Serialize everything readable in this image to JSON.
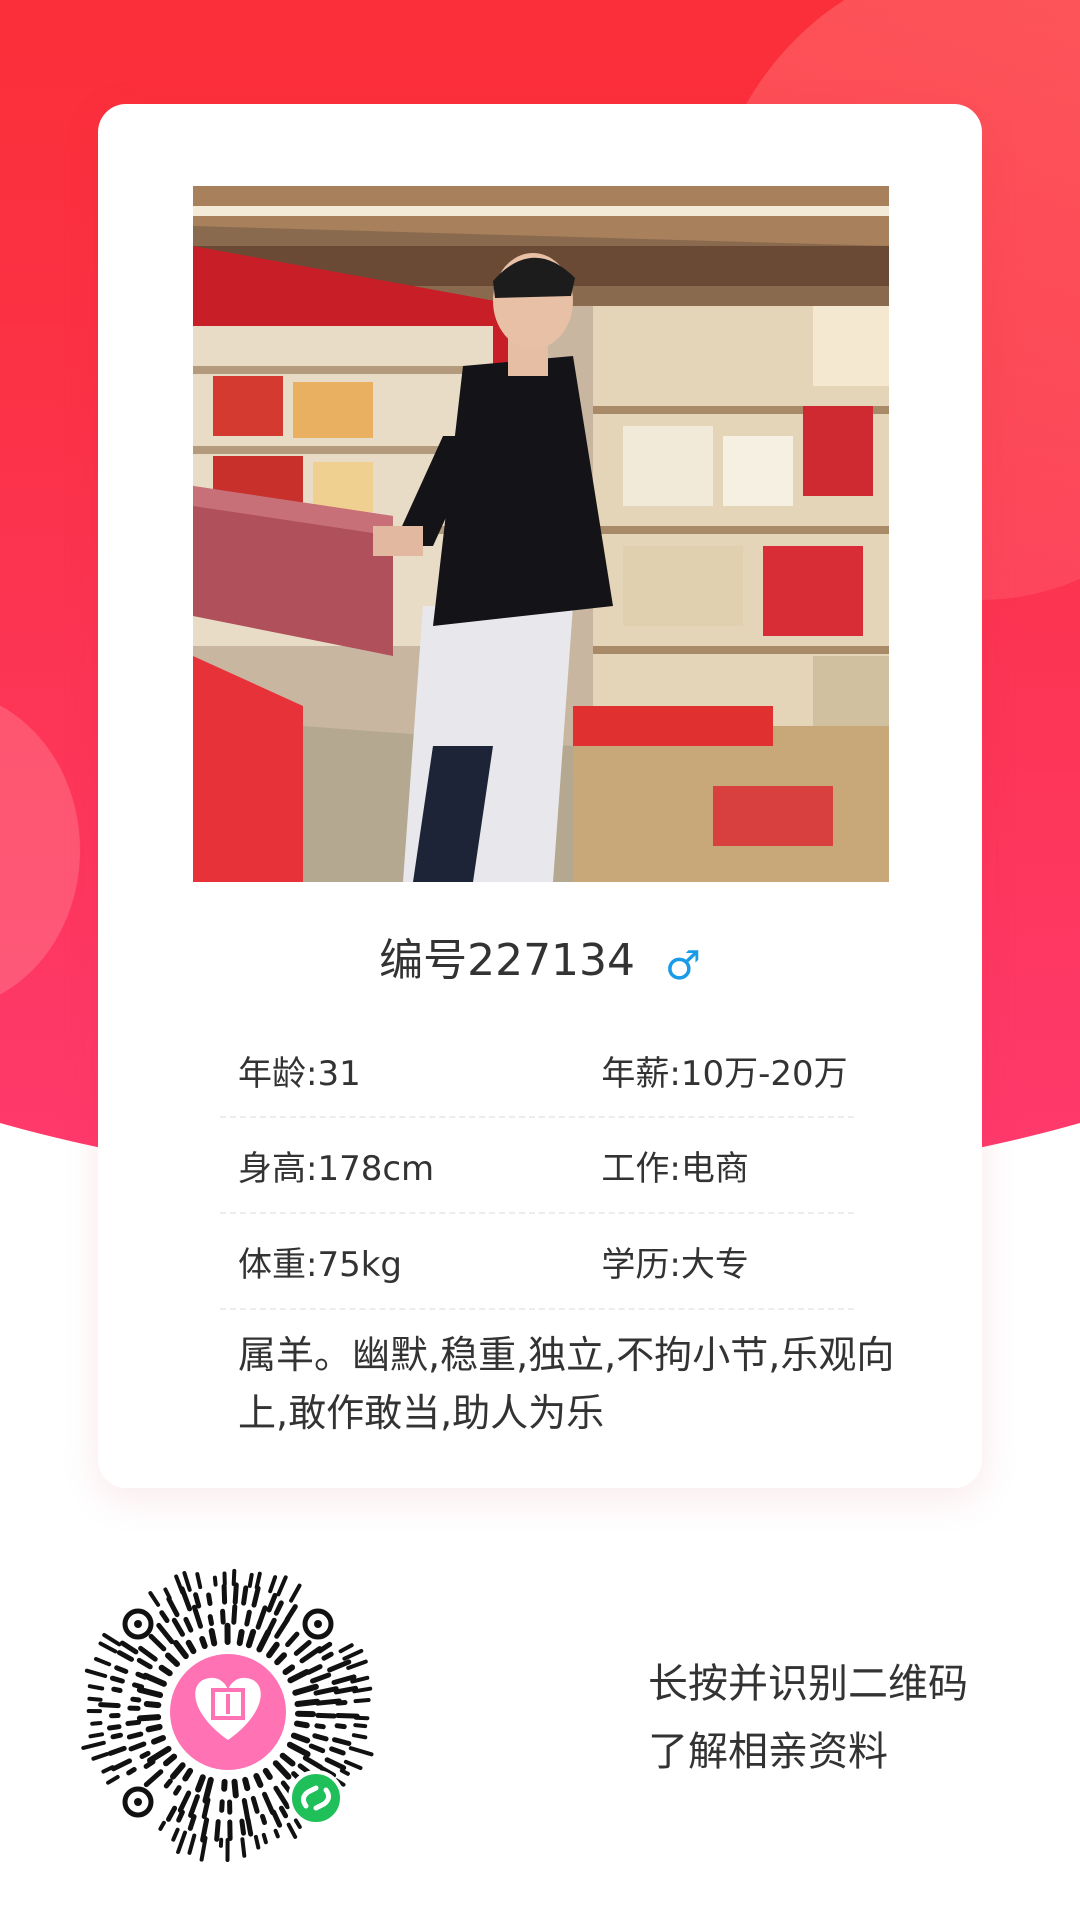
{
  "profile": {
    "id_label": "编号227134",
    "gender_symbol": "♂",
    "age": "年龄:31",
    "salary": "年薪:10万-20万",
    "height": "身高:178cm",
    "job": "工作:电商",
    "weight": "体重:75kg",
    "education": "学历:大专",
    "bio": "属羊。幽默,稳重,独立,不拘小节,乐观向上,敢作敢当,助人为乐"
  },
  "footer": {
    "line1": "长按并识别二维码",
    "line2": "了解相亲资料"
  },
  "colors": {
    "brand_red": "#fa2c2c",
    "brand_pink": "#ff3a6e",
    "gender_blue": "#1a9be8",
    "qr_logo_pink": "#ff73b4",
    "wechat_green": "#1fbf5a"
  }
}
